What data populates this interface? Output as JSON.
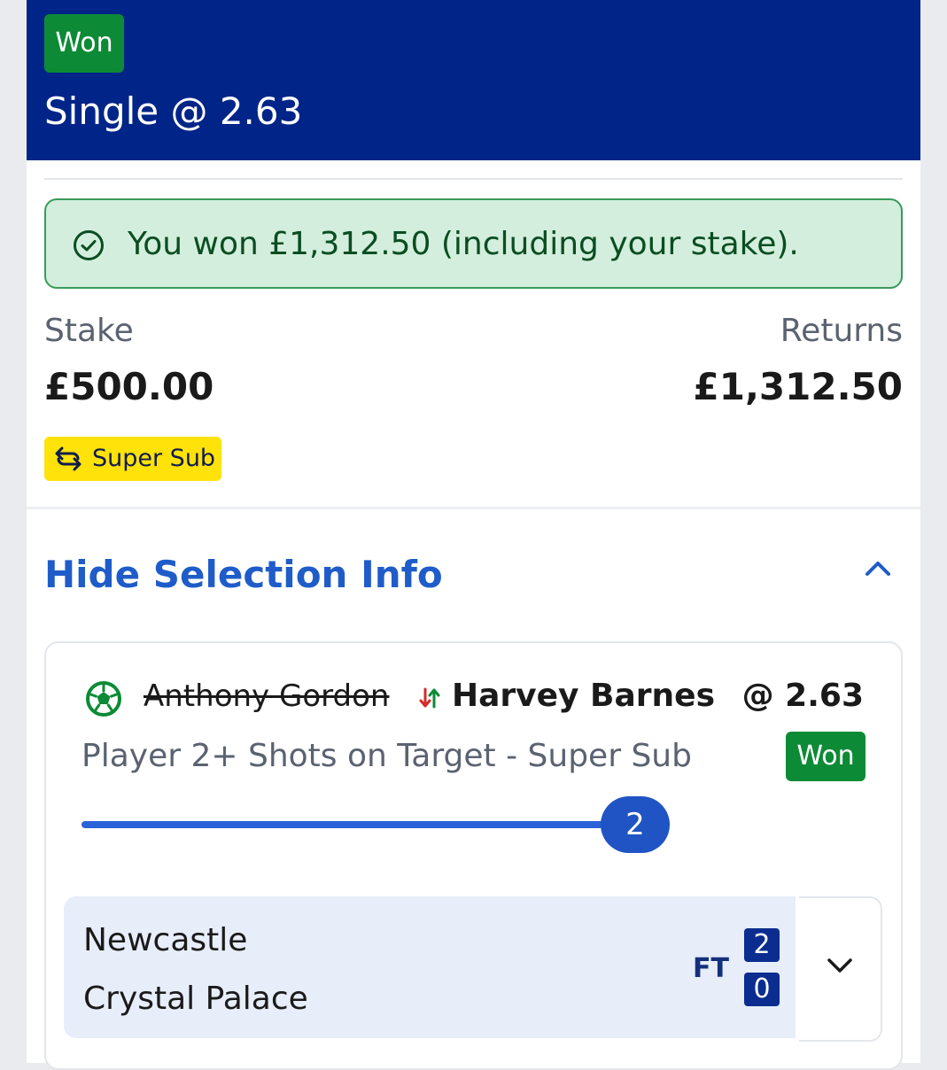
{
  "header": {
    "status_badge": "Won",
    "bet_title": "Single @ 2.63"
  },
  "win_banner": {
    "message": "You won £1,312.50 (including your stake).",
    "icon": "check-circle-icon"
  },
  "summary": {
    "stake_label": "Stake",
    "stake_value": "£500.00",
    "returns_label": "Returns",
    "returns_value": "£1,312.50"
  },
  "promo_tag": {
    "label": "Super Sub",
    "icon": "swap-icon"
  },
  "selection_toggle": {
    "label": "Hide Selection Info",
    "icon": "chevron-up-icon"
  },
  "selection": {
    "original_player": "Anthony Gordon",
    "substitute_player": "Harvey Barnes",
    "odds": "@ 2.63",
    "market": "Player 2+ Shots on Target - Super Sub",
    "status": "Won",
    "progress": {
      "target": 2,
      "current": 2,
      "fraction": 1.0,
      "label": "2"
    }
  },
  "event": {
    "home_team": "Newcastle",
    "away_team": "Crystal Palace",
    "period": "FT",
    "home_score": "2",
    "away_score": "0"
  },
  "colors": {
    "header_bg": "#002487",
    "won_green": "#0d8a36",
    "banner_bg": "#d3eedc",
    "link_blue": "#1f5cc9",
    "super_sub_yellow": "#ffe20a"
  }
}
